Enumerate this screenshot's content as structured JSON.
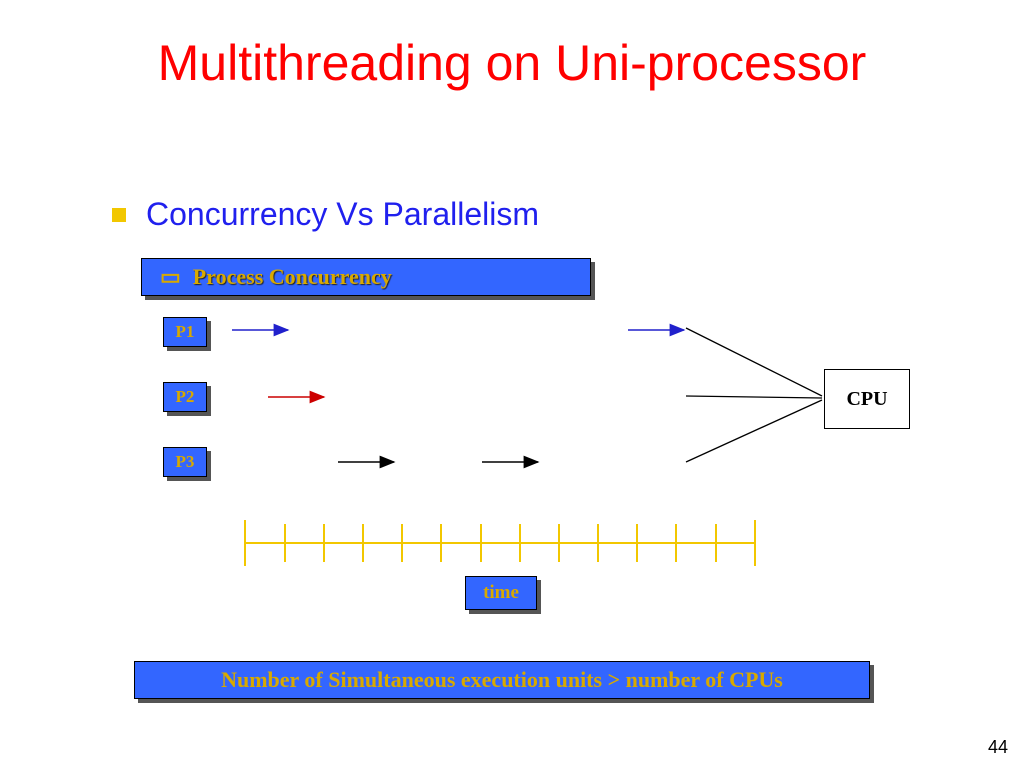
{
  "title": "Multithreading on Uni-processor",
  "bullet": "Concurrency  Vs  Parallelism",
  "header_label": "Process Concurrency",
  "processes": {
    "p1": "P1",
    "p2": "P2",
    "p3": "P3"
  },
  "cpu_label": "CPU",
  "time_label": "time",
  "bottom_note": "Number of Simultaneous execution units > number of CPUs",
  "page_number": "44"
}
